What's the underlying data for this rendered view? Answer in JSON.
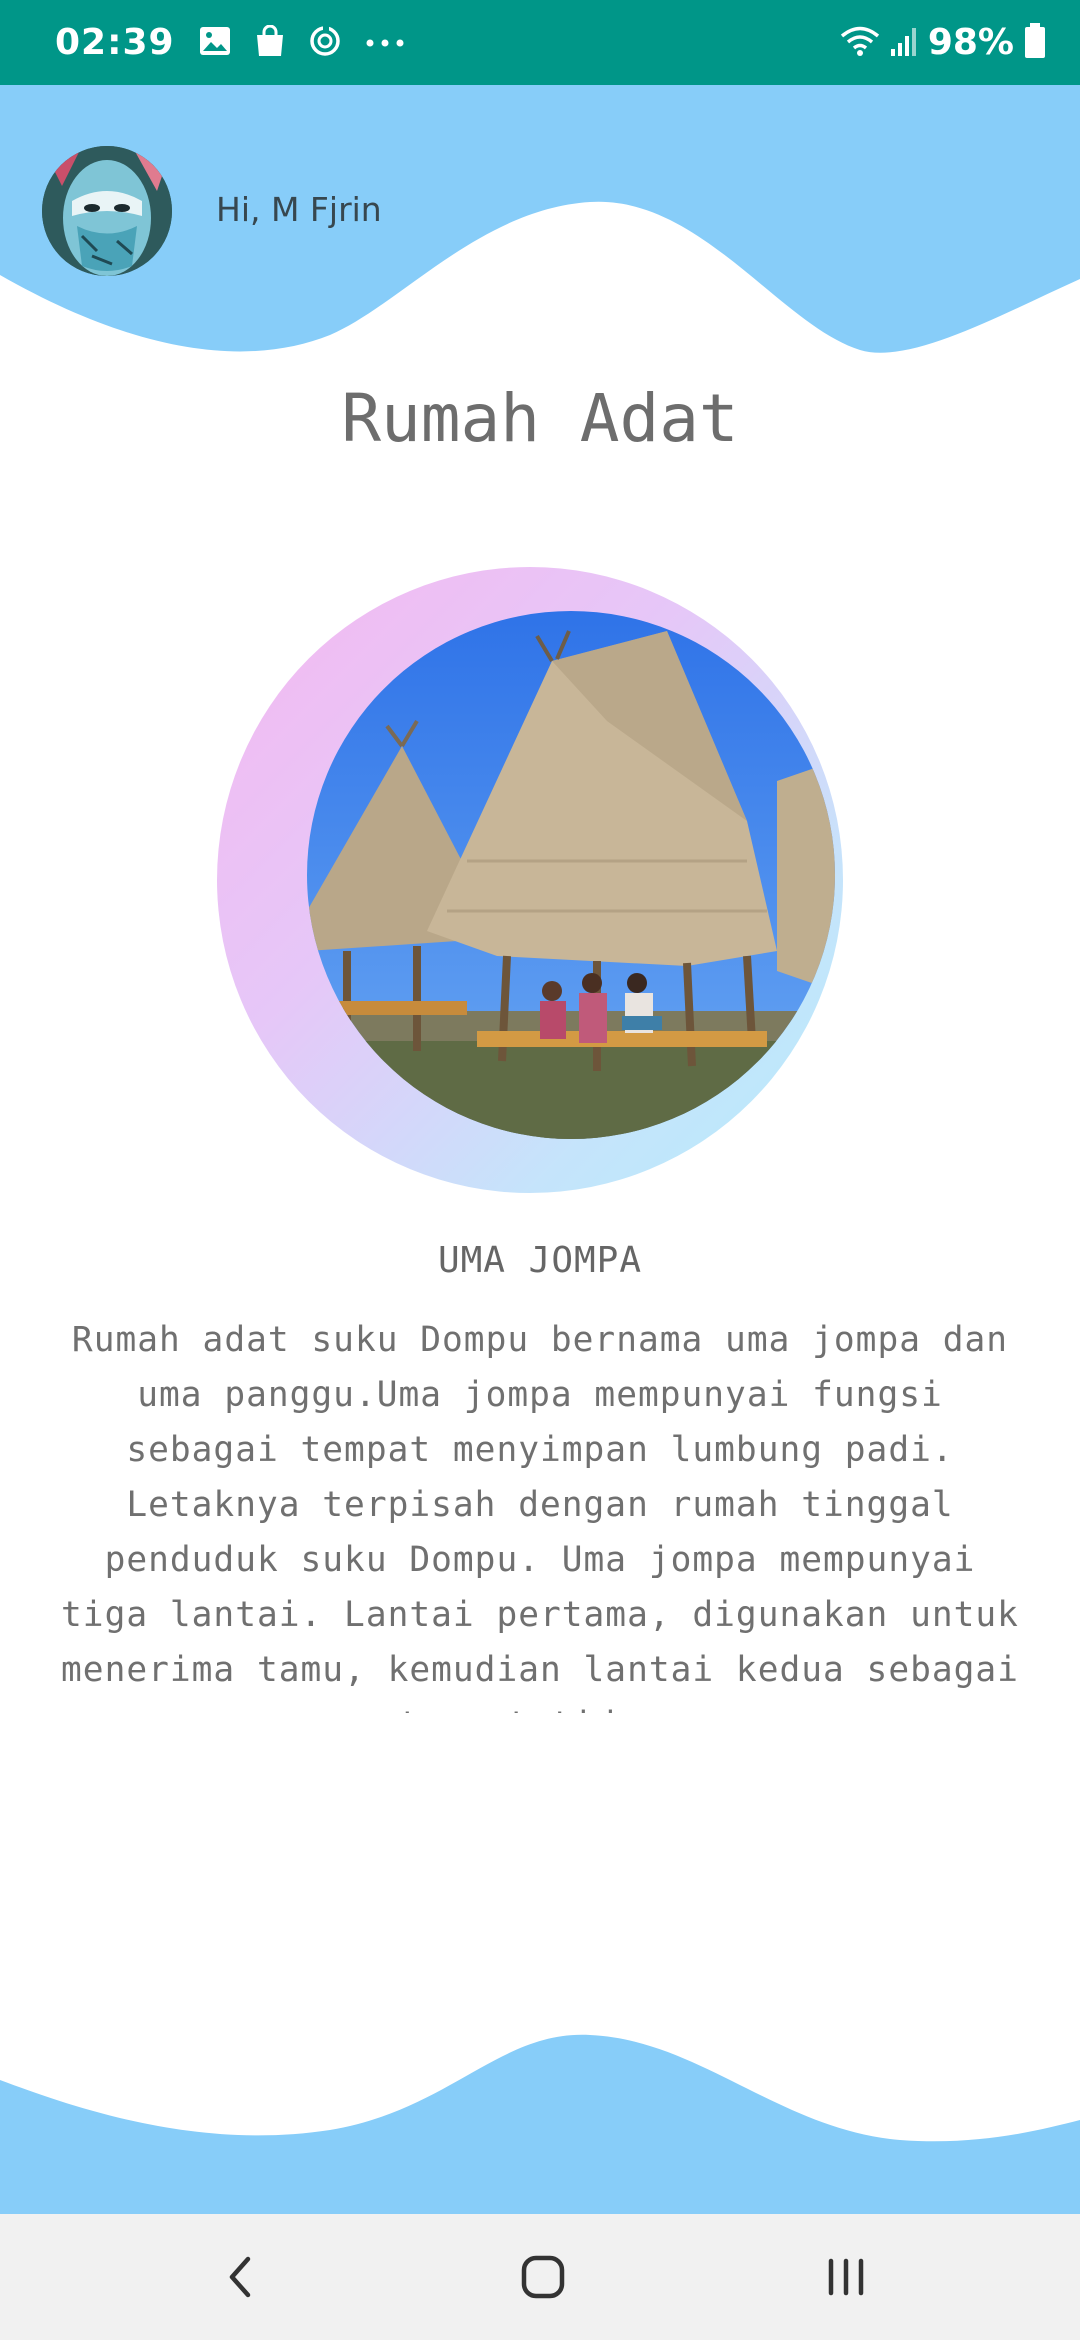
{
  "status_bar": {
    "time": "02:39",
    "battery": "98%",
    "notification_icons": [
      "image-icon",
      "shopping-bag-icon",
      "sync-icon",
      "more-dots-icon"
    ],
    "system_icons": [
      "wifi-icon",
      "signal-icon",
      "battery-icon"
    ]
  },
  "header": {
    "greeting": "Hi, M Fjrin",
    "wave_color": "#87cdf9"
  },
  "page": {
    "title": "Rumah Adat",
    "subtitle": "UMA JOMPA",
    "description": "Rumah adat suku Dompu bernama uma jompa dan uma panggu.Uma jompa mempunyai fungsi sebagai tempat menyimpan lumbung padi. Letaknya terpisah dengan rumah tinggal penduduk suku Dompu. Uma jompa mempunyai tiga lantai. Lantai pertama, digunakan untuk menerima tamu, kemudian lantai kedua sebagai tempat tidur."
  },
  "nav_bar": {
    "icons": [
      "back-icon",
      "home-icon",
      "recent-apps-icon"
    ]
  },
  "colors": {
    "status_bar": "#009688",
    "accent_wave": "#87cdf9",
    "text_gray": "#6d6d6d"
  }
}
